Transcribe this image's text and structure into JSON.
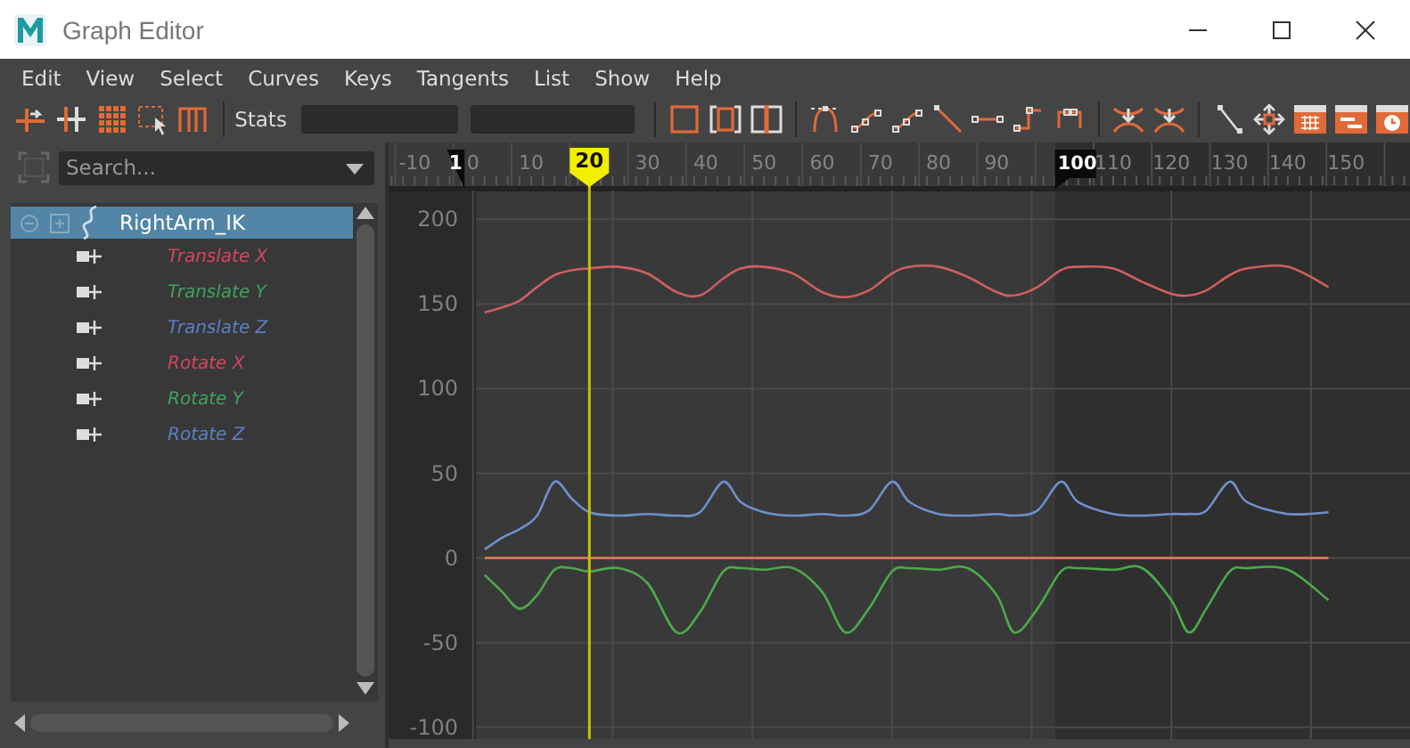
{
  "window": {
    "title": "Graph Editor"
  },
  "menu": [
    "Edit",
    "View",
    "Select",
    "Curves",
    "Keys",
    "Tangents",
    "List",
    "Show",
    "Help"
  ],
  "toolbar": {
    "stats_label": "Stats"
  },
  "outliner": {
    "search": {
      "placeholder": "Search..."
    },
    "nodes": [
      {
        "label": "RightArm_IK",
        "selected": true,
        "expanded": true,
        "children": [
          {
            "label": "Translate X",
            "color": "#d2465c",
            "selected": false
          },
          {
            "label": "Translate Y",
            "color": "#3ea35c",
            "selected": false
          },
          {
            "label": "Translate Z",
            "color": "#5b7fc4",
            "selected": false
          },
          {
            "label": "Rotate X",
            "color": "#d2465c",
            "selected": false
          },
          {
            "label": "Rotate Y",
            "color": "#3ea35c",
            "selected": false
          },
          {
            "label": "Rotate Z",
            "color": "#5b7fc4",
            "selected": false
          }
        ]
      }
    ]
  },
  "graph": {
    "time_slider": {
      "range_start": "1",
      "range_end": "100",
      "current_time": "20"
    },
    "chart_data": {
      "type": "line",
      "grid": true,
      "x": [
        2,
        5,
        8,
        11,
        14,
        17,
        20,
        25,
        30,
        35,
        39,
        43,
        46,
        50,
        55,
        60,
        64,
        68,
        72,
        75,
        80,
        85,
        90,
        93,
        97,
        101,
        104,
        110,
        115,
        120,
        123,
        126,
        130,
        133,
        140,
        147
      ],
      "series": [
        {
          "color": "#cf5f5f",
          "values": [
            145,
            148,
            152,
            160,
            167,
            170,
            171,
            172,
            168,
            157,
            155,
            165,
            171,
            172,
            168,
            157,
            154,
            158,
            168,
            172,
            172,
            166,
            157,
            155,
            160,
            170,
            172,
            171,
            163,
            156,
            155,
            158,
            167,
            171,
            172,
            160
          ]
        },
        {
          "color": "#4caa4c",
          "values": [
            -10,
            -20,
            -30,
            -22,
            -7,
            -6,
            -8,
            -6,
            -15,
            -44,
            -32,
            -8,
            -6,
            -7,
            -6,
            -20,
            -44,
            -30,
            -8,
            -6,
            -7,
            -6,
            -22,
            -44,
            -30,
            -8,
            -6,
            -7,
            -6,
            -25,
            -44,
            -30,
            -8,
            -6,
            -7,
            -25
          ]
        },
        {
          "color": "#6e90cc",
          "values": [
            5,
            12,
            17,
            25,
            45,
            35,
            27,
            25,
            26,
            25,
            27,
            45,
            33,
            27,
            25,
            26,
            25,
            28,
            45,
            33,
            26,
            25,
            26,
            25,
            28,
            45,
            33,
            26,
            25,
            26,
            26,
            28,
            45,
            33,
            26,
            27
          ]
        },
        {
          "color": "#d9785a",
          "values": [
            0,
            0,
            0,
            0,
            0,
            0,
            0,
            0,
            0,
            0,
            0,
            0,
            0,
            0,
            0,
            0,
            0,
            0,
            0,
            0,
            0,
            0,
            0,
            0,
            0,
            0,
            0,
            0,
            0,
            0,
            0,
            0,
            0,
            0,
            0,
            0
          ]
        }
      ],
      "xlim": [
        -14.5,
        161
      ],
      "ylim": [
        -107,
        217
      ],
      "xticks": [
        -10,
        0,
        10,
        30,
        40,
        50,
        60,
        70,
        80,
        90,
        110,
        120,
        130,
        140,
        150
      ],
      "yticks": [
        200,
        150,
        100,
        50,
        0,
        -50,
        -100
      ]
    }
  }
}
